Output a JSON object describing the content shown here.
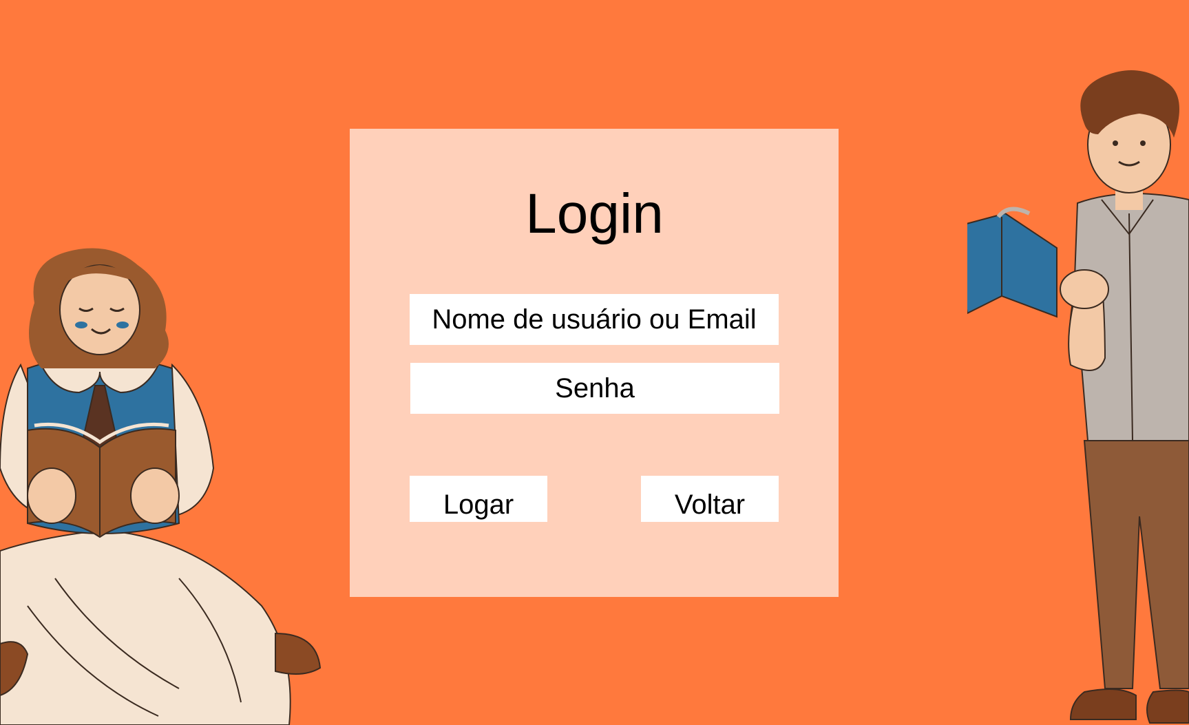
{
  "theme": {
    "background": "#FF793D",
    "card": "#FFD0BA",
    "field": "#FFFFFF"
  },
  "login": {
    "title": "Login",
    "username_placeholder": "Nome de usuário ou Email",
    "password_placeholder": "Senha",
    "submit_label": "Logar",
    "back_label": "Voltar"
  },
  "illustrations": {
    "left": "girl-reading-book-illustration",
    "right": "boy-reading-book-illustration"
  }
}
